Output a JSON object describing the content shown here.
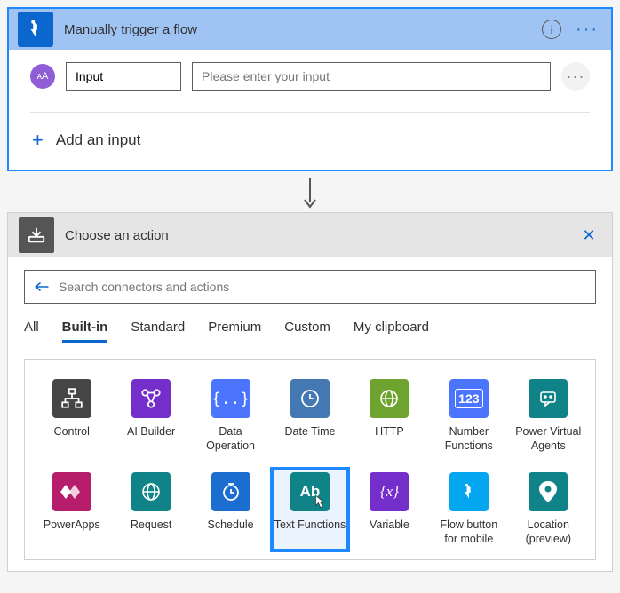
{
  "trigger": {
    "title": "Manually trigger a flow",
    "input_name": "Input",
    "input_placeholder": "Please enter your input",
    "add_label": "Add an input"
  },
  "action": {
    "title": "Choose an action",
    "search_placeholder": "Search connectors and actions",
    "tabs": [
      "All",
      "Built-in",
      "Standard",
      "Premium",
      "Custom",
      "My clipboard"
    ],
    "active_tab": 1,
    "connectors_row1": [
      {
        "label": "Control"
      },
      {
        "label": "AI Builder"
      },
      {
        "label": "Data Operation"
      },
      {
        "label": "Date Time"
      },
      {
        "label": "HTTP"
      },
      {
        "label": "Number Functions"
      },
      {
        "label": "Power Virtual Agents"
      }
    ],
    "connectors_row2": [
      {
        "label": "PowerApps"
      },
      {
        "label": "Request"
      },
      {
        "label": "Schedule"
      },
      {
        "label": "Text Functions"
      },
      {
        "label": "Variable"
      },
      {
        "label": "Flow button for mobile"
      },
      {
        "label": "Location (preview)"
      }
    ],
    "selected": "Text Functions"
  }
}
